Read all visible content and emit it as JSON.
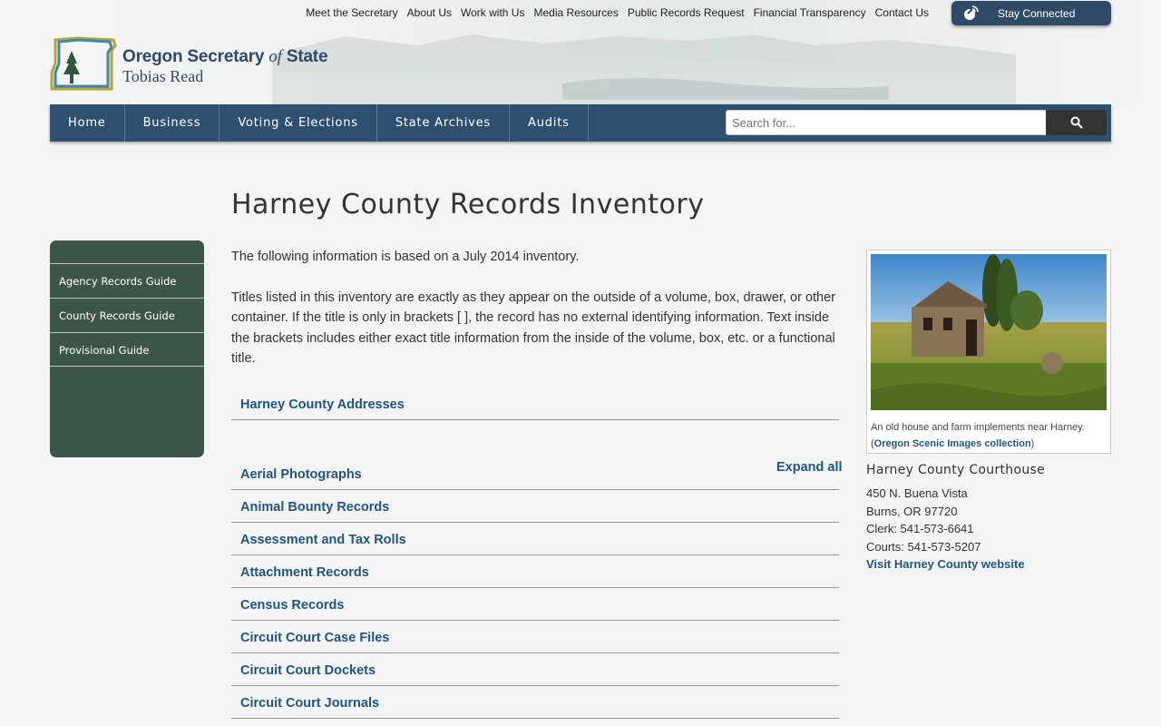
{
  "utility_nav": [
    "Meet the Secretary",
    "About Us",
    "Work with Us",
    "Media Resources",
    "Public Records Request",
    "Financial Transparency",
    "Contact Us"
  ],
  "stay_connected": "Stay Connected",
  "logo": {
    "line1_a": "Oregon Secretary",
    "line1_of": "of",
    "line1_b": "State",
    "line2": "Tobias Read"
  },
  "main_nav": [
    "Home",
    "Business",
    "Voting & Elections",
    "State Archives",
    "Audits"
  ],
  "search": {
    "placeholder": "Search for..."
  },
  "page_title": "Harney County Records Inventory",
  "sidebar": [
    "Agency Records Guide",
    "County Records Guide",
    "Provisional Guide"
  ],
  "intro": {
    "p1": "The following information is based on a July 2014 inventory.",
    "p2": "Titles listed in this inventory are exactly as they appear on the outside of a volume, box, drawer, or other container. If the title is only in brackets [ ], the record has no external identifying information. Text inside the brackets includes either exact title information from the inside of the volume, box, etc. or a functional title."
  },
  "addresses_link": "Harney County Addresses",
  "expand_all": "Expand all",
  "records": [
    "Aerial Photographs",
    "Animal Bounty Records",
    "Assessment and Tax Rolls",
    "Attachment Records",
    "Census Records",
    "Circuit Court Case Files",
    "Circuit Court Dockets",
    "Circuit Court Journals"
  ],
  "photo": {
    "caption_text": "An old house and farm implements near Harney.",
    "caption_open": "(",
    "caption_link": "Oregon Scenic Images collection",
    "caption_close": ")"
  },
  "courthouse": {
    "title": "Harney County Courthouse",
    "address1": "450 N. Buena Vista",
    "address2": "Burns, OR 97720",
    "clerk": "Clerk: 541-573-6641",
    "courts": "Courts: 541-573-5207",
    "website": "Visit Harney County website"
  },
  "colors": {
    "nav_blue": "#2e5070",
    "sidebar_green": "#3e5647",
    "link_blue": "#1f5582"
  }
}
